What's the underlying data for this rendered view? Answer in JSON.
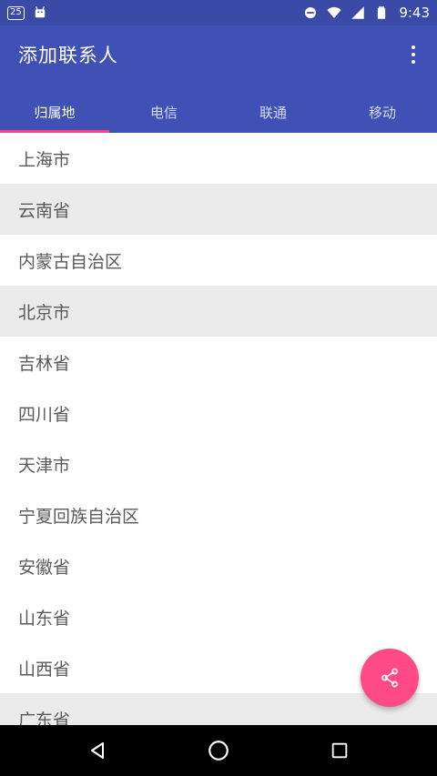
{
  "status_bar": {
    "badge": "25",
    "time": "9:43",
    "icons": [
      "notification-25-icon",
      "android-icon",
      "do-not-disturb-icon",
      "wifi-icon",
      "signal-icon",
      "battery-icon"
    ]
  },
  "app_bar": {
    "title": "添加联系人",
    "menu_icon": "overflow-menu-icon"
  },
  "tabs": [
    {
      "label": "归属地",
      "active": true
    },
    {
      "label": "电信",
      "active": false
    },
    {
      "label": "联通",
      "active": false
    },
    {
      "label": "移动",
      "active": false
    }
  ],
  "list": {
    "items": [
      {
        "label": "上海市"
      },
      {
        "label": "云南省"
      },
      {
        "label": "内蒙古自治区"
      },
      {
        "label": "北京市"
      },
      {
        "label": "吉林省"
      },
      {
        "label": "四川省"
      },
      {
        "label": "天津市"
      },
      {
        "label": "宁夏回族自治区"
      },
      {
        "label": "安徽省"
      },
      {
        "label": "山东省"
      },
      {
        "label": "山西省"
      },
      {
        "label": "广东省"
      }
    ]
  },
  "fab": {
    "icon": "share-icon"
  },
  "nav_bar": {
    "icons": [
      "back-icon",
      "home-icon",
      "recents-icon"
    ]
  },
  "colors": {
    "primary": "#3f51b5",
    "primary_dark": "#3a4aa6",
    "accent": "#ff4081",
    "fab": "#ff4a87"
  }
}
